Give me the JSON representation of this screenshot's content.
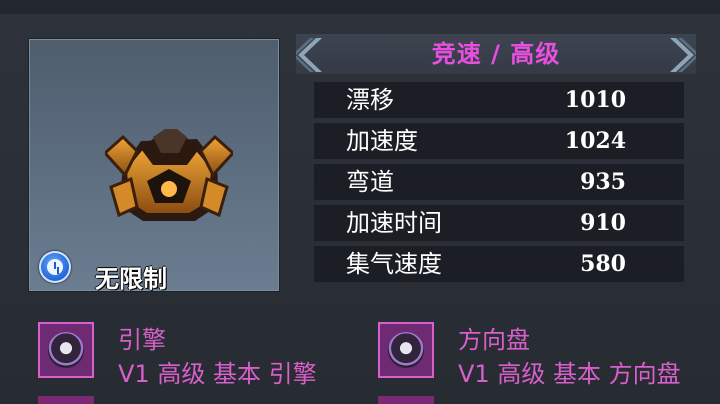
{
  "car": {
    "restriction_label": "无限制"
  },
  "class_bar": {
    "title": "竞速 / 高级"
  },
  "stats": [
    {
      "name": "漂移",
      "value": "1010"
    },
    {
      "name": "加速度",
      "value": "1024"
    },
    {
      "name": "弯道",
      "value": "935"
    },
    {
      "name": "加速时间",
      "value": "910"
    },
    {
      "name": "集气速度",
      "value": "580"
    }
  ],
  "parts": [
    {
      "name": "引擎",
      "desc": "V1 高级 基本 引擎",
      "icon": "engine-icon"
    },
    {
      "name": "方向盘",
      "desc": "V1 高级 基本 方向盘",
      "icon": "steering-wheel-icon"
    }
  ],
  "colors": {
    "accent": "#e84fe0",
    "part_text": "#d85fcc",
    "panel_bg": "#2b2f36"
  }
}
